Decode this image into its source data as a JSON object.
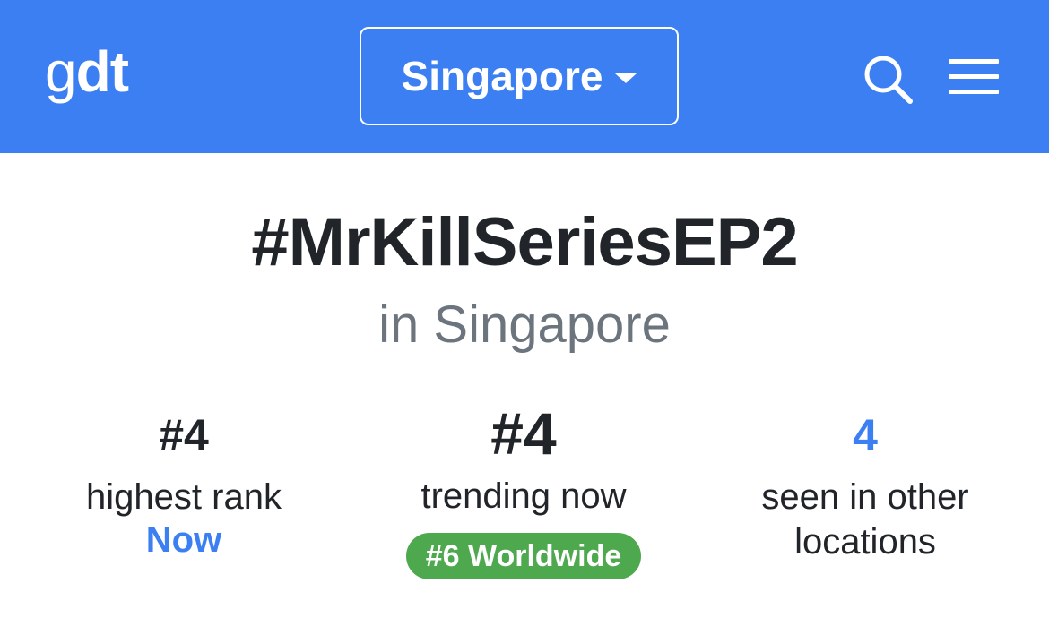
{
  "header": {
    "logo_part1": "g",
    "logo_part2": "dt",
    "location_label": "Singapore",
    "search_icon": "search-icon",
    "menu_icon": "hamburger-menu-icon",
    "background_color": "#3b7ff2"
  },
  "trend": {
    "hashtag": "#MrKillSeriesEP2",
    "location_text": "in Singapore"
  },
  "stats": {
    "highest_rank": {
      "value": "#4",
      "label": "highest rank",
      "when": "Now"
    },
    "trending": {
      "value": "#4",
      "label": "trending now",
      "badge": "#6 Worldwide",
      "badge_color": "#4ea94e"
    },
    "other_locations": {
      "value": "4",
      "label": "seen in other locations"
    }
  },
  "colors": {
    "accent_blue": "#3b7ff2",
    "text_dark": "#212529",
    "text_muted": "#6c757d"
  }
}
